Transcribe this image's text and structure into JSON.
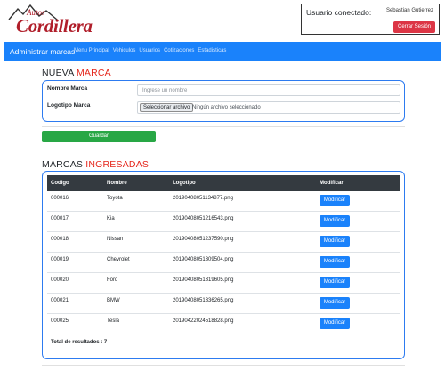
{
  "logo": {
    "small_text": "Autos",
    "big_text": "Cordillera"
  },
  "user": {
    "label": "Usuario conectado:",
    "name": "Sebastian Gutierrez",
    "logout_label": "Cerrar Sesión"
  },
  "navbar": {
    "brand": "Administrar marcas",
    "items": [
      "Menu Principal",
      "Vehiculos",
      "Usuarios",
      "Cotizaciones",
      "Estadisticas"
    ]
  },
  "form": {
    "title_plain": "NUEVA",
    "title_accent": "MARCA",
    "name_label": "Nombre Marca",
    "name_placeholder": "Ingrese un nombre",
    "logo_label": "Logotipo Marca",
    "file_button_label": "Seleccionar archivo",
    "file_status": "Ningún archivo seleccionado",
    "save_label": "Guardar"
  },
  "table": {
    "title_plain": "MARCAS",
    "title_accent": "INGRESADAS",
    "headers": [
      "Codigo",
      "Nombre",
      "Logotipo",
      "Modificar"
    ],
    "rows": [
      {
        "codigo": "000016",
        "nombre": "Toyota",
        "logotipo": "20190408051134877.png",
        "action": "Modificar"
      },
      {
        "codigo": "000017",
        "nombre": "Kia",
        "logotipo": "20190408051216543.png",
        "action": "Modificar"
      },
      {
        "codigo": "000018",
        "nombre": "Nissan",
        "logotipo": "20190408051237590.png",
        "action": "Modificar"
      },
      {
        "codigo": "000019",
        "nombre": "Chevrolet",
        "logotipo": "20190408051309504.png",
        "action": "Modificar"
      },
      {
        "codigo": "000020",
        "nombre": "Ford",
        "logotipo": "20190408051319605.png",
        "action": "Modificar"
      },
      {
        "codigo": "000021",
        "nombre": "BMW",
        "logotipo": "20190408051336265.png",
        "action": "Modificar"
      },
      {
        "codigo": "000025",
        "nombre": "Tesla",
        "logotipo": "20190422024518828.png",
        "action": "Modificar"
      }
    ],
    "total_label": "Total de resultados : 7"
  },
  "colors": {
    "primary": "#1a82fb",
    "danger": "#dc3545",
    "success": "#28a745",
    "accent_red": "#e5261b",
    "table_header": "#343a40"
  }
}
